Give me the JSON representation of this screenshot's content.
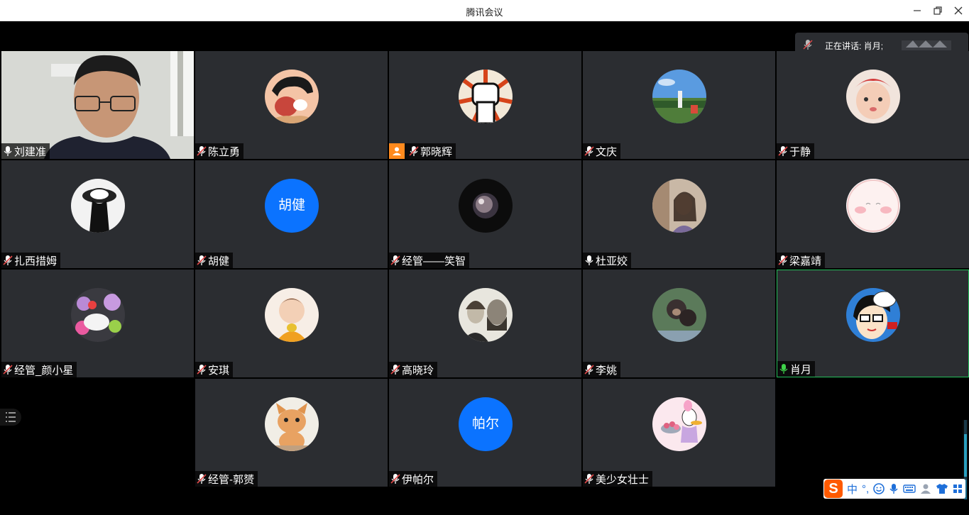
{
  "window": {
    "title": "腾讯会议"
  },
  "speaking": {
    "label": "正在讲话:",
    "name": "肖月;"
  },
  "participants": [
    {
      "name": "刘建准",
      "avatar": "camera-feed",
      "mic": "on"
    },
    {
      "name": "陈立勇",
      "avatar": "cartoon-boy",
      "mic": "muted"
    },
    {
      "name": "郭晓辉",
      "avatar": "raised-fist",
      "mic": "muted",
      "host": true
    },
    {
      "name": "文庆",
      "avatar": "outdoor-photo",
      "mic": "muted"
    },
    {
      "name": "于静",
      "avatar": "baby-photo",
      "mic": "muted"
    },
    {
      "name": "扎西措姆",
      "avatar": "hat-woman",
      "mic": "muted"
    },
    {
      "name": "胡健",
      "avatar_text": "胡健",
      "mic": "muted"
    },
    {
      "name": "经管——笑智",
      "avatar": "dark-orb",
      "mic": "muted"
    },
    {
      "name": "杜亚姣",
      "avatar": "woman-photo",
      "mic": "on"
    },
    {
      "name": "梁嘉靖",
      "avatar": "blush-face",
      "mic": "muted"
    },
    {
      "name": "经管_颜小星",
      "avatar": "flowers-photo",
      "mic": "muted"
    },
    {
      "name": "安琪",
      "avatar": "girl-photo",
      "mic": "muted"
    },
    {
      "name": "高晓玲",
      "avatar": "portraits-photo",
      "mic": "muted"
    },
    {
      "name": "李姚",
      "avatar": "monkeys-photo",
      "mic": "muted"
    },
    {
      "name": "肖月",
      "avatar": "cartoon-glasses",
      "mic": "speaking",
      "active": true
    },
    {
      "name": "经管-郭赟",
      "avatar": "cat-photo",
      "mic": "muted"
    },
    {
      "name": "伊帕尔",
      "avatar_text": "帕尔",
      "mic": "muted"
    },
    {
      "name": "美少女壮士",
      "avatar": "duck-cartoon",
      "mic": "muted"
    }
  ],
  "ime": {
    "brand": "S",
    "lang": "中",
    "punct": "°,"
  },
  "colors": {
    "tile": "#2b2d31",
    "accent_blue": "#0b73ff",
    "speaking_green": "#24c05c",
    "host_orange": "#ff8a1e"
  }
}
